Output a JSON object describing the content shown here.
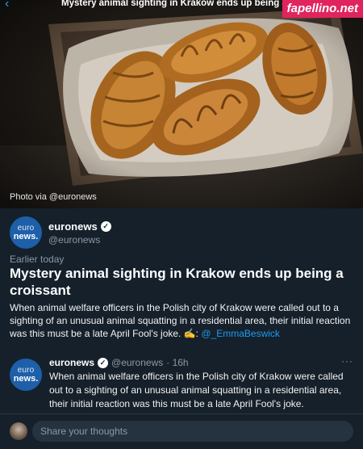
{
  "topbar": {
    "title": "Mystery animal sighting in Krakow ends up being a croissant",
    "back_icon": "chevron-left-icon",
    "watermark": "fapellino.net"
  },
  "hero": {
    "photo_credit": "Photo via @euronews"
  },
  "publisher": {
    "avatar_line1": "euro",
    "avatar_line2": "news.",
    "name": "euronews",
    "handle": "@euronews",
    "verified_icon": "verified-badge-icon"
  },
  "story": {
    "timestamp": "Earlier today",
    "headline": "Mystery animal sighting in Krakow ends up being a croissant",
    "summary": "When animal welfare officers in the Polish city of Krakow were called out to a sighting of an unusual animal squatting in a residential area, their initial reaction was this must be a late April Fool's joke.",
    "credit_emoji": "✍️:",
    "credit_link": "@_EmmaBeswick"
  },
  "tweet": {
    "name": "euronews",
    "handle": "@euronews",
    "time": "· 16h",
    "more_icon": "more-horizontal-icon",
    "text": "When animal welfare officers in the Polish city of Krakow were called out to a sighting of an unusual animal squatting in a residential area, their initial reaction was this must be a late April Fool's joke."
  },
  "composer": {
    "placeholder": "Share your thoughts"
  },
  "colors": {
    "background": "#15202b",
    "accent": "#1d9bf0",
    "secondary_text": "#8b98a5",
    "euronews_blue": "#1d5fa8"
  }
}
